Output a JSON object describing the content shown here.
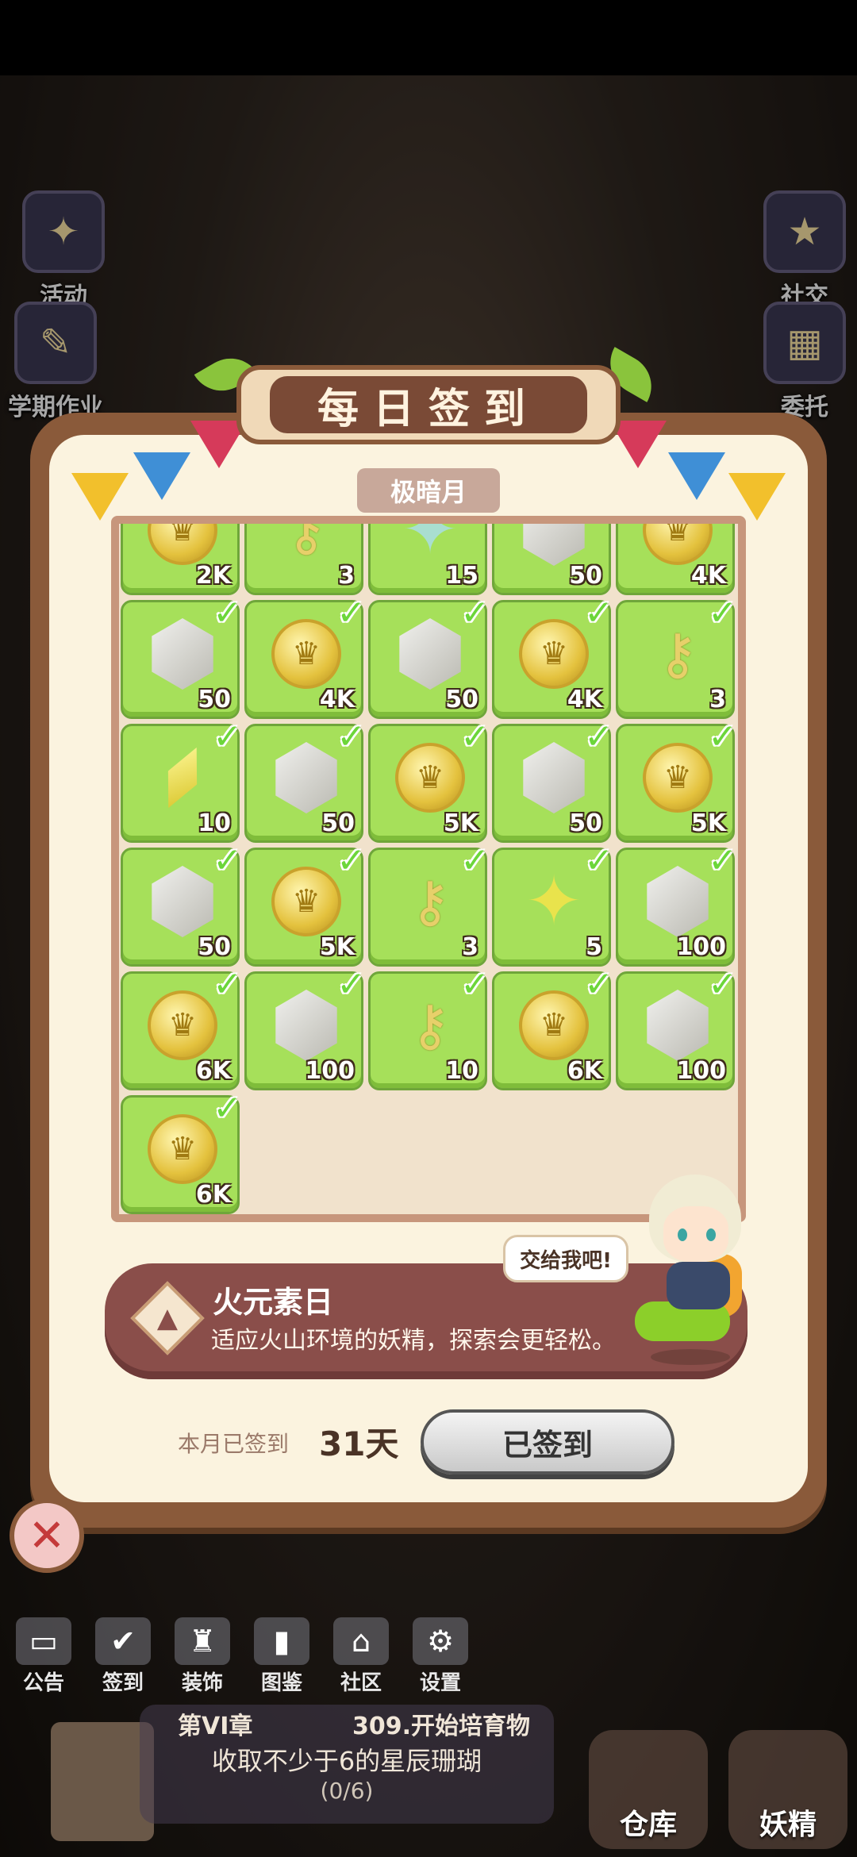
{
  "side_left": [
    {
      "label": "活动",
      "icon": "event-icon"
    },
    {
      "label": "学期作业",
      "icon": "homework-icon"
    }
  ],
  "side_right": [
    {
      "label": "社交",
      "icon": "social-icon"
    },
    {
      "label": "委托",
      "icon": "commission-icon"
    }
  ],
  "dialog": {
    "title": "每日签到",
    "month": "极暗月",
    "rewards": [
      {
        "type": "coin",
        "qty": "2K",
        "checked": false
      },
      {
        "type": "key",
        "qty": "3",
        "checked": false
      },
      {
        "type": "star-teal",
        "qty": "15",
        "checked": false
      },
      {
        "type": "gem",
        "qty": "50",
        "checked": false
      },
      {
        "type": "coin",
        "qty": "4K",
        "checked": false
      },
      {
        "type": "gem",
        "qty": "50",
        "checked": true
      },
      {
        "type": "coin",
        "qty": "4K",
        "checked": true
      },
      {
        "type": "gem",
        "qty": "50",
        "checked": true
      },
      {
        "type": "coin",
        "qty": "4K",
        "checked": true
      },
      {
        "type": "key",
        "qty": "3",
        "checked": true
      },
      {
        "type": "crystal",
        "qty": "10",
        "checked": true
      },
      {
        "type": "gem",
        "qty": "50",
        "checked": true
      },
      {
        "type": "coin",
        "qty": "5K",
        "checked": true
      },
      {
        "type": "gem",
        "qty": "50",
        "checked": true
      },
      {
        "type": "coin",
        "qty": "5K",
        "checked": true
      },
      {
        "type": "gem",
        "qty": "50",
        "checked": true
      },
      {
        "type": "coin",
        "qty": "5K",
        "checked": true
      },
      {
        "type": "key",
        "qty": "3",
        "checked": true
      },
      {
        "type": "star",
        "qty": "5",
        "checked": true
      },
      {
        "type": "gem",
        "qty": "100",
        "checked": true
      },
      {
        "type": "coin",
        "qty": "6K",
        "checked": true
      },
      {
        "type": "gem",
        "qty": "100",
        "checked": true
      },
      {
        "type": "key",
        "qty": "10",
        "checked": true
      },
      {
        "type": "coin",
        "qty": "6K",
        "checked": true
      },
      {
        "type": "gem",
        "qty": "100",
        "checked": true
      },
      {
        "type": "coin",
        "qty": "6K",
        "checked": true
      }
    ],
    "element_day": {
      "title": "火元素日",
      "desc": "适应火山环境的妖精，探索会更轻松。",
      "bubble": "交给我吧!"
    },
    "signed_label": "本月已签到",
    "signed_days": "31天",
    "signed_button": "已签到"
  },
  "bottom_nav": [
    {
      "label": "公告",
      "icon": "notice-icon"
    },
    {
      "label": "签到",
      "icon": "checkin-icon"
    },
    {
      "label": "装饰",
      "icon": "decorate-icon"
    },
    {
      "label": "图鉴",
      "icon": "codex-icon"
    },
    {
      "label": "社区",
      "icon": "community-icon"
    },
    {
      "label": "设置",
      "icon": "settings-icon"
    }
  ],
  "quest": {
    "chapter": "第VI章",
    "step": "309.开始培育物",
    "title": "收取不少于6的星辰珊瑚",
    "progress": "(0/6)"
  },
  "big_buttons": {
    "warehouse": "仓库",
    "fairy": "妖精"
  }
}
